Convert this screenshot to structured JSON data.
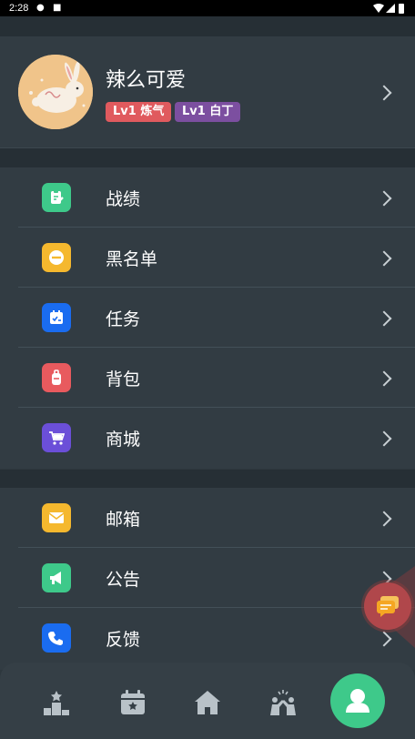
{
  "status_bar": {
    "time": "2:28"
  },
  "profile": {
    "nickname": "辣么可爱",
    "badges": [
      "Lv1 炼气",
      "Lv1 白丁"
    ]
  },
  "menu_group1": [
    {
      "label": "战绩",
      "icon": "record-icon",
      "color": "#3ec98a"
    },
    {
      "label": "黑名单",
      "icon": "blacklist-icon",
      "color": "#f5b82e"
    },
    {
      "label": "任务",
      "icon": "task-icon",
      "color": "#1a6cf0"
    },
    {
      "label": "背包",
      "icon": "backpack-icon",
      "color": "#e85a5e"
    },
    {
      "label": "商城",
      "icon": "cart-icon",
      "color": "#6b4fd8"
    }
  ],
  "menu_group2": [
    {
      "label": "邮箱",
      "icon": "mail-icon",
      "color": "#f5b82e"
    },
    {
      "label": "公告",
      "icon": "megaphone-icon",
      "color": "#3ec98a"
    },
    {
      "label": "反馈",
      "icon": "phone-icon",
      "color": "#1a6cf0"
    }
  ],
  "tabbar": {
    "tabs": [
      "ranking-icon",
      "calendar-icon",
      "home-icon",
      "celebration-icon",
      "profile-icon"
    ],
    "active": "profile-icon",
    "active_color": "#3ec98a"
  },
  "floating_button": {
    "icon": "chat-icon",
    "color": "#b0474b"
  }
}
